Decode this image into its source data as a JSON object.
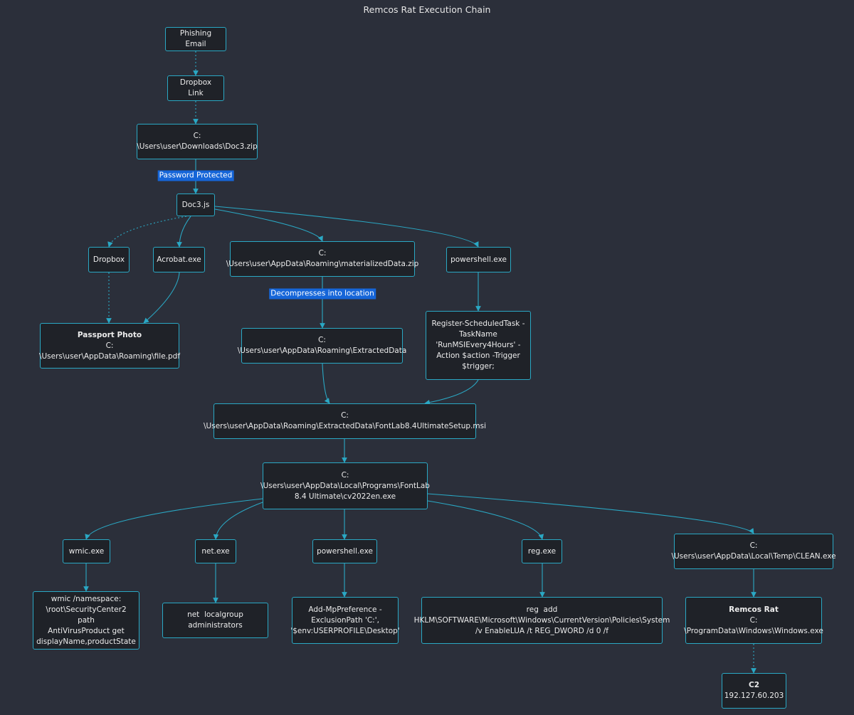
{
  "title": "Remcos Rat Execution Chain",
  "colors": {
    "background": "#2b2f3a",
    "node_fill": "#1f2228",
    "node_border": "#2aa8c4",
    "edge": "#2aa8c4",
    "edge_label_bg": "#1565d8"
  },
  "nodes": {
    "phishing": {
      "lines": [
        "Phishing Email"
      ]
    },
    "dropbox_link": {
      "lines": [
        "Dropbox Link"
      ]
    },
    "doc3_zip": {
      "lines": [
        "C:",
        "\\Users\\user\\Downloads\\Doc3.zip"
      ]
    },
    "doc3_js": {
      "lines": [
        "Doc3.js"
      ]
    },
    "dropbox": {
      "lines": [
        "Dropbox"
      ]
    },
    "acrobat": {
      "lines": [
        "Acrobat.exe"
      ]
    },
    "materialized": {
      "lines": [
        "C:",
        "\\Users\\user\\AppData\\Roaming\\materializedData.zip"
      ]
    },
    "powershell1": {
      "lines": [
        "powershell.exe"
      ]
    },
    "passport": {
      "title": "Passport Photo",
      "lines": [
        "C:",
        "\\Users\\user\\AppData\\Roaming\\file.pdf"
      ]
    },
    "extracted": {
      "lines": [
        "C:",
        "\\Users\\user\\AppData\\Roaming\\ExtractedData"
      ]
    },
    "schedtask": {
      "lines": [
        "Register-ScheduledTask -",
        "TaskName",
        "'RunMSIEvery4Hours' -",
        "Action $action -Trigger",
        "$trigger;"
      ]
    },
    "msi": {
      "lines": [
        "C:",
        "\\Users\\user\\AppData\\Roaming\\ExtractedData\\FontLab8.4UltimateSetup.msi"
      ]
    },
    "cv2022": {
      "lines": [
        "C:",
        "\\Users\\user\\AppData\\Local\\Programs\\FontLab",
        "8.4 Ultimate\\cv2022en.exe"
      ]
    },
    "wmic": {
      "lines": [
        "wmic.exe"
      ]
    },
    "net": {
      "lines": [
        "net.exe"
      ]
    },
    "powershell2": {
      "lines": [
        "powershell.exe"
      ]
    },
    "reg": {
      "lines": [
        "reg.exe"
      ]
    },
    "clean": {
      "lines": [
        "C:",
        "\\Users\\user\\AppData\\Local\\Temp\\CLEAN.exe"
      ]
    },
    "wmic_cmd": {
      "lines": [
        "wmic /namespace:",
        "\\root\\SecurityCenter2 path",
        "AntiVirusProduct get",
        "displayName,productState"
      ]
    },
    "net_cmd": {
      "lines": [
        "net  localgroup",
        "administrators"
      ]
    },
    "mppref": {
      "lines": [
        "Add-MpPreference -",
        "ExclusionPath 'C:',",
        "'$env:USERPROFILE\\Desktop'"
      ]
    },
    "reg_cmd": {
      "lines": [
        "reg  add",
        "HKLM\\SOFTWARE\\Microsoft\\Windows\\CurrentVersion\\Policies\\System",
        "/v EnableLUA /t REG_DWORD /d 0 /f"
      ]
    },
    "remcos": {
      "title": "Remcos Rat",
      "lines": [
        "C:",
        "\\ProgramData\\Windows\\Windows.exe"
      ]
    },
    "c2": {
      "title": "C2",
      "lines": [
        "192.127.60.203"
      ]
    }
  },
  "edges": [
    {
      "from": "phishing",
      "to": "dropbox_link",
      "style": "dotted"
    },
    {
      "from": "dropbox_link",
      "to": "doc3_zip",
      "style": "dotted"
    },
    {
      "from": "doc3_zip",
      "to": "doc3_js",
      "style": "solid",
      "label": "Password Protected"
    },
    {
      "from": "doc3_js",
      "to": "dropbox",
      "style": "dotted"
    },
    {
      "from": "doc3_js",
      "to": "acrobat",
      "style": "solid"
    },
    {
      "from": "doc3_js",
      "to": "materialized",
      "style": "solid"
    },
    {
      "from": "doc3_js",
      "to": "powershell1",
      "style": "solid"
    },
    {
      "from": "dropbox",
      "to": "passport",
      "style": "dotted"
    },
    {
      "from": "acrobat",
      "to": "passport",
      "style": "solid"
    },
    {
      "from": "materialized",
      "to": "extracted",
      "style": "solid",
      "label": "Decompresses into location"
    },
    {
      "from": "powershell1",
      "to": "schedtask",
      "style": "solid"
    },
    {
      "from": "extracted",
      "to": "msi",
      "style": "solid"
    },
    {
      "from": "schedtask",
      "to": "msi",
      "style": "solid"
    },
    {
      "from": "msi",
      "to": "cv2022",
      "style": "solid"
    },
    {
      "from": "cv2022",
      "to": "wmic",
      "style": "solid"
    },
    {
      "from": "cv2022",
      "to": "net",
      "style": "solid"
    },
    {
      "from": "cv2022",
      "to": "powershell2",
      "style": "solid"
    },
    {
      "from": "cv2022",
      "to": "reg",
      "style": "solid"
    },
    {
      "from": "cv2022",
      "to": "clean",
      "style": "solid"
    },
    {
      "from": "wmic",
      "to": "wmic_cmd",
      "style": "solid"
    },
    {
      "from": "net",
      "to": "net_cmd",
      "style": "solid"
    },
    {
      "from": "powershell2",
      "to": "mppref",
      "style": "solid"
    },
    {
      "from": "reg",
      "to": "reg_cmd",
      "style": "solid"
    },
    {
      "from": "clean",
      "to": "remcos",
      "style": "solid"
    },
    {
      "from": "remcos",
      "to": "c2",
      "style": "dotted"
    }
  ]
}
